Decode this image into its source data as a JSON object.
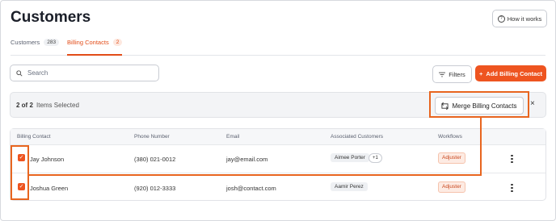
{
  "page": {
    "title": "Customers",
    "how_it_works": "How it works"
  },
  "tabs": [
    {
      "label": "Customers",
      "count": "283",
      "active": false
    },
    {
      "label": "Billing Contacts",
      "count": "2",
      "active": true
    }
  ],
  "toolbar": {
    "search_placeholder": "Search",
    "filters_label": "Filters",
    "add_label": "Add Billing Contact"
  },
  "selection": {
    "count": "2 of 2",
    "text": "Items Selected",
    "merge_label": "Merge Billing Contacts",
    "close": "×"
  },
  "table": {
    "columns": [
      "Billing Contact",
      "Phone Number",
      "Email",
      "Associated Customers",
      "Workflows"
    ],
    "rows": [
      {
        "name": "Jay Johnson",
        "phone": "(380) 021-0012",
        "email": "jay@email.com",
        "customer": "Aimee Porter",
        "extra": "+1",
        "workflow": "Adjuster",
        "checked": true
      },
      {
        "name": "Joshua Green",
        "phone": "(920) 012-3333",
        "email": "josh@contact.com",
        "customer": "Aamir Perez",
        "extra": "",
        "workflow": "Adjuster",
        "checked": true
      }
    ]
  },
  "colors": {
    "accent": "#ee5420",
    "highlight": "#e8651f"
  }
}
